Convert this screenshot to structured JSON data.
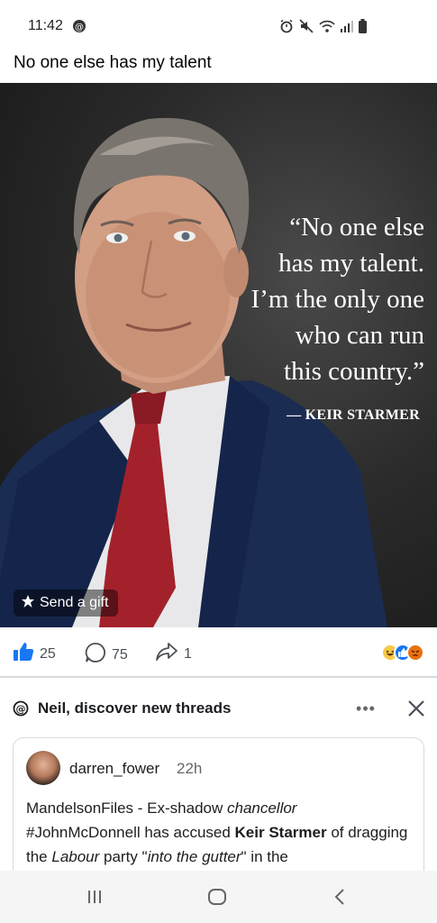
{
  "status_bar": {
    "time": "11:42"
  },
  "post": {
    "text": "No one else has my talent"
  },
  "image": {
    "quote_line1": "“No one else",
    "quote_line2": "has my talent.",
    "quote_line3": "I’m the only one",
    "quote_line4": "who can run",
    "quote_line5": "this country.”",
    "attribution": "— KEIR STARMER",
    "gift_label": "Send a gift"
  },
  "reactions": {
    "likes": "25",
    "comments": "75",
    "shares": "1"
  },
  "threads_promo": {
    "title": "Neil, discover new threads",
    "card": {
      "username": "darren_fower",
      "time": "22h",
      "body_part1": "MandelsonFiles - Ex-shadow ",
      "body_italic1": "chancellor",
      "body_part2": " #JohnMcDonnell has accused ",
      "body_bold1": "Keir Starmer",
      "body_part3": " of dragging the ",
      "body_italic2": "Labour",
      "body_part4": " party \"",
      "body_italic3": "into the gutter",
      "body_part5": "\" in the"
    }
  },
  "colors": {
    "like_blue": "#1877f2",
    "suit_navy": "#1b2c52",
    "tie_red": "#a3212b"
  }
}
